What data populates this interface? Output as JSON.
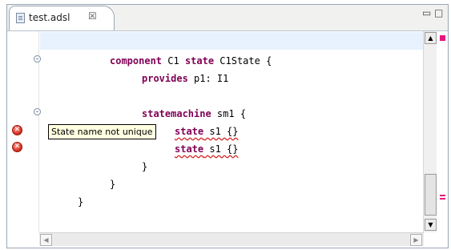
{
  "tab": {
    "label": "test.adsl",
    "close_glyph": "☒",
    "icon": "file-icon"
  },
  "window_controls": {
    "minimize": "▭",
    "maximize": "□"
  },
  "code": {
    "line1_kw1": "component",
    "line1_mid": " C1 ",
    "line1_kw2": "state",
    "line1_rest": " C1State {",
    "line2_kw": "provides",
    "line2_rest": " p1: I1",
    "line4_kw": "statemachine",
    "line4_rest": " sm1 {",
    "line5_kw": "state",
    "line5_rest": " s1 {}",
    "line6_kw": "state",
    "line6_rest": " s1 {}",
    "line7": "}",
    "line8": "}",
    "line9": "}"
  },
  "tooltip": {
    "text": "State name not unique"
  },
  "markers": {
    "error_icon": "error-icon",
    "fold_icon": "fold-collapse-icon",
    "error_color": "#d0271a",
    "overview_color": "#e8157a"
  },
  "scrollbar": {
    "up": "▲",
    "down": "▼",
    "left": "◀",
    "right": "▶"
  }
}
